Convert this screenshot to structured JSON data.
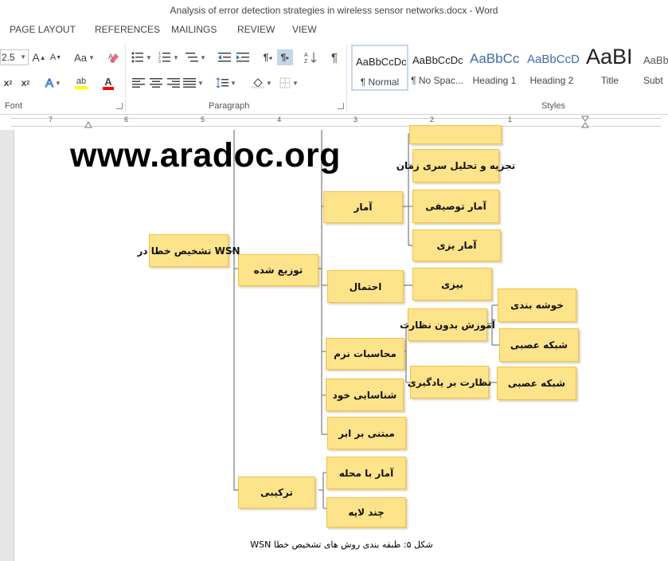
{
  "window": {
    "title": "Analysis of error detection strategies in wireless sensor networks.docx - Word"
  },
  "tabs": [
    "PAGE LAYOUT",
    "REFERENCES",
    "MAILINGS",
    "REVIEW",
    "VIEW"
  ],
  "ribbon": {
    "font_size": "2.5",
    "font_group_label": "Font",
    "paragraph_group_label": "Paragraph",
    "styles_group_label": "Styles",
    "grow_font": "A",
    "shrink_font": "A",
    "change_case": "Aa",
    "subscript": "x",
    "superscript": "x",
    "text_effects": "A",
    "highlight": "ab",
    "font_color": "A",
    "show_hide": "¶",
    "ltr": "¶",
    "rtl": "¶",
    "highlight_color": "#ffff00",
    "font_color_value": "#ff0000",
    "styles": [
      {
        "sample": "AaBbCcDc",
        "name": "¶ Normal",
        "selected": true
      },
      {
        "sample": "AaBbCcDc",
        "name": "¶ No Spac...",
        "selected": false
      },
      {
        "sample": "AaBbCc",
        "name": "Heading 1",
        "selected": false
      },
      {
        "sample": "AaBbCcD",
        "name": "Heading 2",
        "selected": false
      },
      {
        "sample": "AaBI",
        "name": "Title",
        "selected": false
      },
      {
        "sample": "AaBb",
        "name": "Subt",
        "selected": false
      }
    ]
  },
  "ruler": {
    "numbers": [
      "7",
      "6",
      "5",
      "4",
      "3",
      "2",
      "1"
    ]
  },
  "document": {
    "watermark": "www.aradoc.org",
    "diagram": {
      "root": "تشخیص خطا در WSN",
      "distributed": "توزیع شده",
      "hybrid": "ترکیبی",
      "statistics": "آمار",
      "probability": "احتمال",
      "soft_computing": "محاسبات نرم",
      "self_identification": "شناسایی خود",
      "cloud_based": "مبتنی بر ابر",
      "time_series": "تجزیه و تحلیل سری زمان",
      "descriptive_stats": "آمار توصیفی",
      "stats_planning": "آمار یزی",
      "bayes": "بیزی",
      "unsupervised": "آموزش بدون نظارت",
      "supervised": "نظارت بر یادگیری",
      "clustering": "خوشه بندی",
      "neural_net_1": "شبکه عصبی",
      "neural_net_2": "شبکه عصبی",
      "local_stats": "آمار با محله",
      "multilayer": "چند لایه"
    },
    "caption": "شکل ۵: طبقه بندی روش های تشخیص خطا WSN"
  }
}
